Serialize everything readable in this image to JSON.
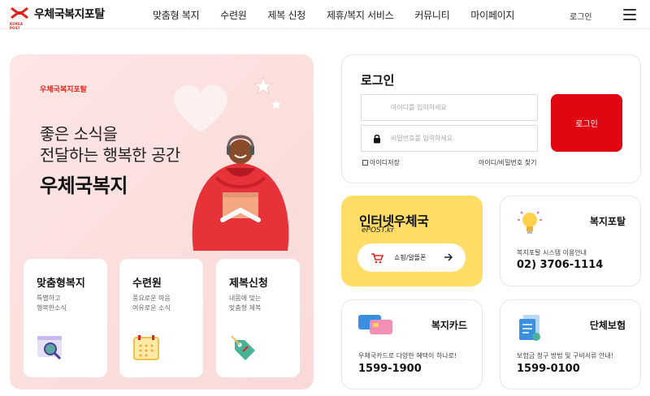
{
  "header": {
    "logo_text": "우체국복지포탈",
    "logo_sub": "KOREA POST",
    "nav": [
      "맞춤형 복지",
      "수련원",
      "제복 신청",
      "제휴/복지 서비스",
      "커뮤니티",
      "마이페이지"
    ],
    "login_link": "로그인"
  },
  "hero": {
    "brand": "우체국복지포탈",
    "line1": "좋은 소식을",
    "line2": "전달하는 행복한 공간",
    "title": "우체국복지",
    "cards": [
      {
        "title": "맞춤형복지",
        "desc1": "특별하고",
        "desc2": "행복한소식"
      },
      {
        "title": "수련원",
        "desc1": "풍요로운 마음",
        "desc2": "여유로운 소식"
      },
      {
        "title": "제복신청",
        "desc1": "내몸에 맞는",
        "desc2": "맞춤형 제복"
      }
    ]
  },
  "login": {
    "title": "로그인",
    "id_placeholder": "아이디를 입력하세요",
    "pw_placeholder": "비밀번호를 입력하세요",
    "button": "로그인",
    "save_id": "아이디저장",
    "find": "아이디/비밀번호 찾기"
  },
  "epost": {
    "title": "인터넷우체국",
    "sub": "ePOST.kr",
    "button": "쇼핑/알뜰폰"
  },
  "welfare_portal": {
    "title": "복지포탈",
    "desc": "복지포탈 시스템 이용안내",
    "phone": "02) 3706-1114"
  },
  "welfare_card": {
    "title": "복지카드",
    "desc": "우체국카드로 다양한 혜택이 하나로!",
    "phone": "1599-1900"
  },
  "group_insurance": {
    "title": "단체보험",
    "desc": "보험금 청구 방법 및 구비서류 안내!",
    "phone": "1599-0100"
  },
  "colors": {
    "brand_red": "#e00713",
    "hero_bg": "#fbe0de",
    "epost_yellow": "#ffdd66"
  }
}
